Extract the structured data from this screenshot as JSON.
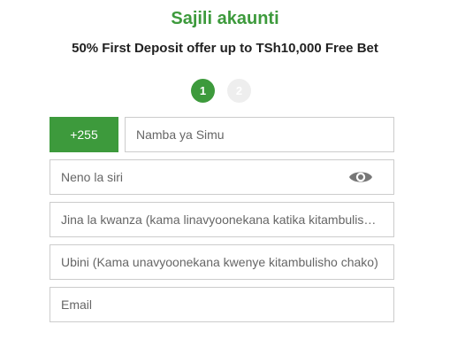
{
  "header": {
    "title": "Sajili akaunti",
    "subtitle": "50% First Deposit offer up to TSh10,000 Free Bet"
  },
  "steps": {
    "current": "1",
    "next": "2"
  },
  "form": {
    "country_code": "+255",
    "phone_placeholder": "Namba ya Simu",
    "password_placeholder": "Neno la siri",
    "password_toggle_icon": "eye-icon",
    "first_name_placeholder": "Jina la kwanza (kama linavyoonekana katika kitambulisho chako)",
    "last_name_placeholder": "Ubini (Kama unavyoonekana kwenye kitambulisho chako)",
    "email_placeholder": "Email"
  },
  "colors": {
    "brand_green": "#3d9a3c",
    "step_inactive": "#eeeeee",
    "border": "#cccccc"
  }
}
